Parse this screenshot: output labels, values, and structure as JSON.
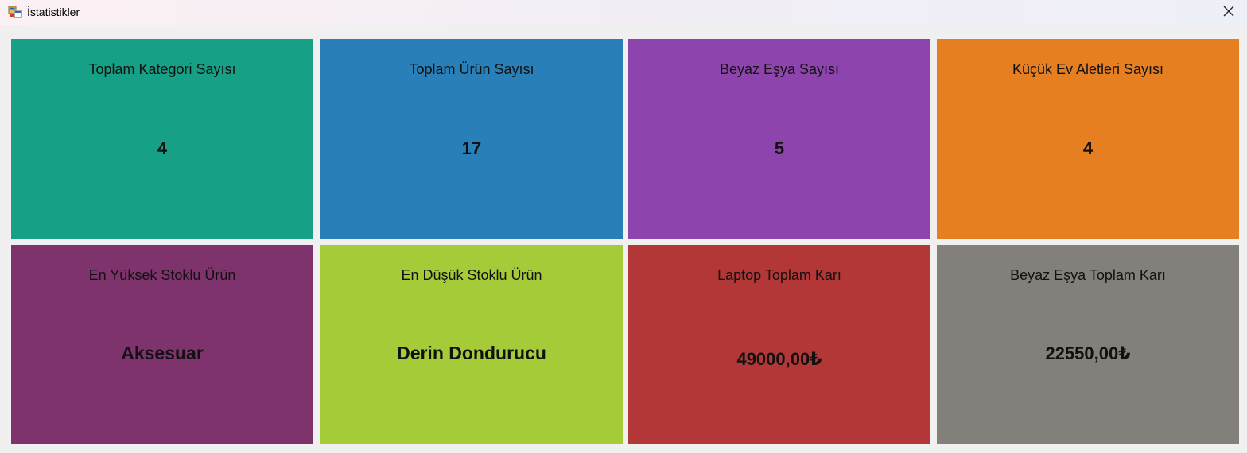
{
  "window": {
    "title": "İstatistikler",
    "close_icon": "close-icon",
    "app_icon": "form-icon"
  },
  "tiles": [
    {
      "label": "Toplam Kategori Sayısı",
      "value": "4",
      "color": "#16a085"
    },
    {
      "label": "Toplam Ürün Sayısı",
      "value": "17",
      "color": "#2980b9"
    },
    {
      "label": "Beyaz Eşya Sayısı",
      "value": "5",
      "color": "#8e44ad"
    },
    {
      "label": "Küçük Ev Aletleri Sayısı",
      "value": "4",
      "color": "#e67e22"
    },
    {
      "label": "En Yüksek Stoklu Ürün",
      "value": "Aksesuar",
      "color": "#7f336d"
    },
    {
      "label": "En Düşük Stoklu Ürün",
      "value": "Derin Dondurucu",
      "color": "#a6cb38"
    },
    {
      "label": "Laptop Toplam Karı",
      "value": "49000,00₺",
      "color": "#b33737"
    },
    {
      "label": "Beyaz Eşya Toplam Karı",
      "value": "22550,00₺",
      "color": "#83807b"
    }
  ]
}
